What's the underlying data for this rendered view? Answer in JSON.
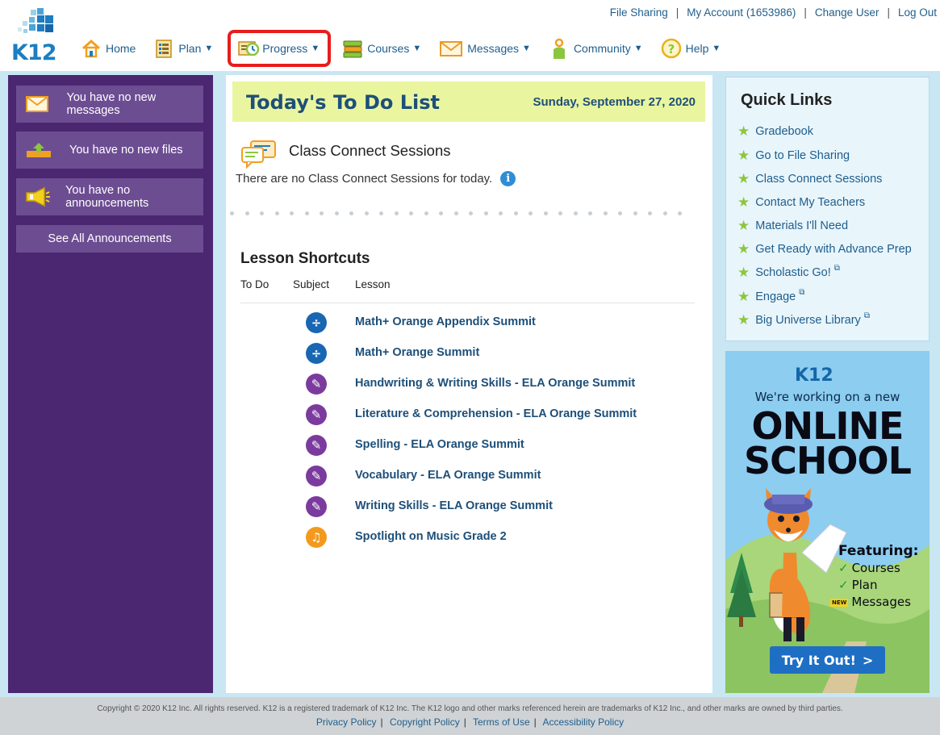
{
  "header": {
    "logo_text": "K12",
    "top_links": [
      {
        "label": "File Sharing"
      },
      {
        "label": "My Account (1653986)"
      },
      {
        "label": "Change User"
      },
      {
        "label": "Log Out"
      }
    ],
    "nav": [
      {
        "label": "Home",
        "icon": "home-icon",
        "has_menu": false
      },
      {
        "label": "Plan",
        "icon": "plan-icon",
        "has_menu": true
      },
      {
        "label": "Progress",
        "icon": "progress-icon",
        "has_menu": true,
        "highlighted": true
      },
      {
        "label": "Courses",
        "icon": "courses-icon",
        "has_menu": true
      },
      {
        "label": "Messages",
        "icon": "messages-icon",
        "has_menu": true
      },
      {
        "label": "Community",
        "icon": "community-icon",
        "has_menu": true
      },
      {
        "label": "Help",
        "icon": "help-icon",
        "has_menu": true
      }
    ],
    "caret": "▼"
  },
  "sidebar": {
    "cards": [
      {
        "text": "You have no new messages",
        "icon": "envelope-icon"
      },
      {
        "text": "You have no new files",
        "icon": "upload-icon"
      },
      {
        "text": "You have no announcements",
        "icon": "megaphone-icon"
      }
    ],
    "see_all": "See All Announcements"
  },
  "todo": {
    "title": "Today's To Do List",
    "date": "Sunday, September 27, 2020",
    "class_connect": {
      "title": "Class Connect Sessions",
      "message": "There are no Class Connect Sessions for today."
    },
    "lesson_shortcuts": {
      "title": "Lesson Shortcuts",
      "columns": [
        "To Do",
        "Subject",
        "Lesson"
      ],
      "rows": [
        {
          "subject": "math",
          "icon": "divide-icon",
          "color": "#1966b3",
          "lesson": "Math+ Orange Appendix Summit"
        },
        {
          "subject": "math",
          "icon": "divide-icon",
          "color": "#1966b3",
          "lesson": "Math+ Orange Summit"
        },
        {
          "subject": "ela",
          "icon": "pencil-icon",
          "color": "#7b3b9e",
          "lesson": "Handwriting & Writing Skills - ELA Orange Summit"
        },
        {
          "subject": "ela",
          "icon": "pencil-icon",
          "color": "#7b3b9e",
          "lesson": "Literature & Comprehension - ELA Orange Summit"
        },
        {
          "subject": "ela",
          "icon": "pencil-icon",
          "color": "#7b3b9e",
          "lesson": "Spelling - ELA Orange Summit"
        },
        {
          "subject": "ela",
          "icon": "pencil-icon",
          "color": "#7b3b9e",
          "lesson": "Vocabulary - ELA Orange Summit"
        },
        {
          "subject": "ela",
          "icon": "pencil-icon",
          "color": "#7b3b9e",
          "lesson": "Writing Skills - ELA Orange Summit"
        },
        {
          "subject": "music",
          "icon": "music-note-icon",
          "color": "#f39a1e",
          "lesson": "Spotlight on Music Grade 2"
        }
      ]
    }
  },
  "quick_links": {
    "title": "Quick Links",
    "items": [
      {
        "label": "Gradebook",
        "external": false
      },
      {
        "label": "Go to File Sharing",
        "external": false
      },
      {
        "label": "Class Connect Sessions",
        "external": false
      },
      {
        "label": "Contact My Teachers",
        "external": false
      },
      {
        "label": "Materials I'll Need",
        "external": false
      },
      {
        "label": "Get Ready with Advance Prep",
        "external": false
      },
      {
        "label": "Scholastic Go!",
        "external": true
      },
      {
        "label": "Engage",
        "external": true
      },
      {
        "label": "Big Universe Library",
        "external": true
      }
    ]
  },
  "promo": {
    "logo": "K12",
    "subtitle": "We're working on a new",
    "headline_1": "ONLINE",
    "headline_2": "SCHOOL",
    "featuring": "Featuring:",
    "features": [
      {
        "label": "Courses",
        "badge": ""
      },
      {
        "label": "Plan",
        "badge": ""
      },
      {
        "label": "Messages",
        "badge": "NEW"
      }
    ],
    "button": "Try It Out!",
    "button_arrow": ">"
  },
  "footer": {
    "copyright": "Copyright © 2020 K12 Inc. All rights reserved. K12 is a registered trademark of K12 Inc. The K12 logo and other marks referenced herein are trademarks of K12 Inc., and other marks are owned by third parties.",
    "links": [
      "Privacy Policy",
      "Copyright Policy",
      "Terms of Use",
      "Accessibility Policy"
    ]
  },
  "colors": {
    "sidebar_bg": "#4b2671",
    "card_bg": "#6c4d92",
    "todo_header_bg": "#eaf5a0",
    "link_blue": "#1d4f79",
    "highlight_red": "#e81c1c",
    "main_bg": "#c9e6f3"
  }
}
